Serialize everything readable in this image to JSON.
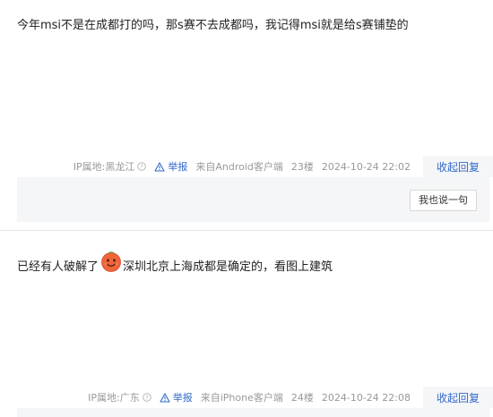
{
  "posts": [
    {
      "text": "今年msi不是在成都打的吗，那s赛不去成都吗，我记得msi就是给s赛铺垫的",
      "ip_location": "IP属地:黑龙江",
      "report_label": "举报",
      "client": "来自Android客户端",
      "floor": "23楼",
      "time": "2024-10-24 22:02",
      "collapse_label": "收起回复",
      "reply_button_label": "我也说一句"
    },
    {
      "text_before_emoji": "已经有人破解了",
      "emoji_icon": "smiling-face-emoji-icon",
      "text_after_emoji": "深圳北京上海成都是确定的，看图上建筑",
      "ip_location": "IP属地:广东",
      "report_label": "举报",
      "client": "来自iPhone客户端",
      "floor": "24楼",
      "time": "2024-10-24 22:08",
      "collapse_label": "收起回复"
    }
  ],
  "colors": {
    "link": "#3169c9",
    "meta_text": "#999999",
    "reply_bg": "#f5f6f8"
  }
}
